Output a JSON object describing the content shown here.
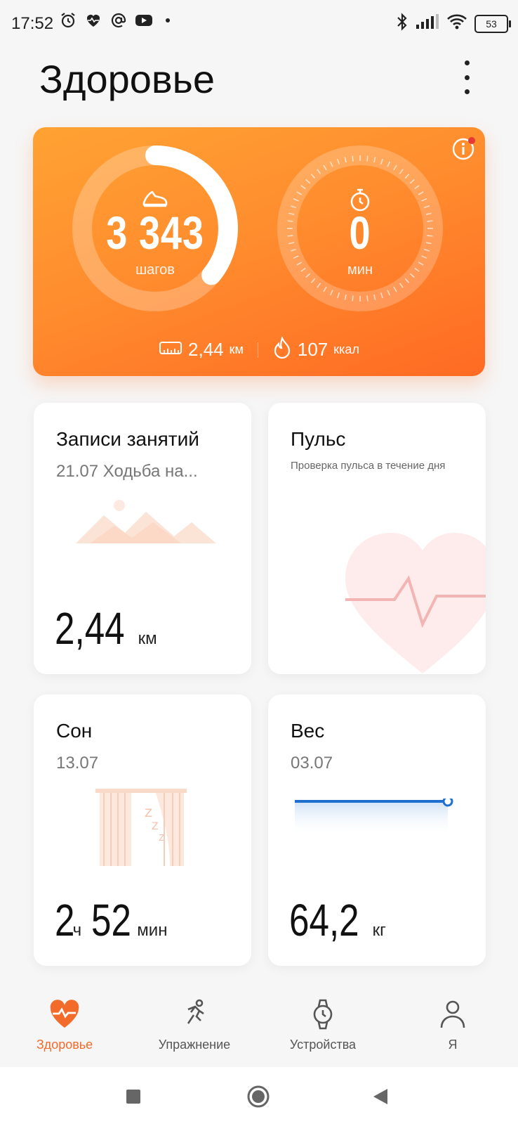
{
  "status_bar": {
    "time": "17:52",
    "left_icons": [
      "alarm-icon",
      "heart-rate-icon",
      "at-icon",
      "youtube-icon"
    ],
    "right_icons": [
      "bluetooth-icon",
      "signal-icon",
      "wifi-icon"
    ],
    "battery": "53"
  },
  "header": {
    "title": "Здоровье"
  },
  "activity": {
    "steps": {
      "value": "3 343",
      "unit": "шагов",
      "progress": 0.36
    },
    "active_minutes": {
      "value": "0",
      "unit": "мин"
    },
    "distance": {
      "value": "2,44",
      "unit": "км"
    },
    "calories": {
      "value": "107",
      "unit": "ккал"
    },
    "colors": {
      "start": "#ffa233",
      "end": "#ff6a23"
    }
  },
  "tiles": {
    "records": {
      "title": "Записи занятий",
      "subtitle": "21.07 Ходьба на...",
      "value": "2,44",
      "unit": "км"
    },
    "pulse": {
      "title": "Пульс",
      "description": "Проверка пульса в течение дня"
    },
    "sleep": {
      "title": "Сон",
      "subtitle": "13.07",
      "hours": "2",
      "hours_unit": "ч",
      "minutes": "52",
      "minutes_unit": "мин"
    },
    "weight": {
      "title": "Вес",
      "subtitle": "03.07",
      "value": "64,2",
      "unit": "кг"
    }
  },
  "bottom_nav": {
    "items": [
      {
        "label": "Здоровье",
        "icon": "heart-icon",
        "active": true
      },
      {
        "label": "Упражнение",
        "icon": "running-icon",
        "active": false
      },
      {
        "label": "Устройства",
        "icon": "watch-icon",
        "active": false
      },
      {
        "label": "Я",
        "icon": "profile-icon",
        "active": false
      }
    ],
    "accent": "#f26b2a"
  },
  "system_nav": [
    "recents-button",
    "home-button",
    "back-button"
  ]
}
